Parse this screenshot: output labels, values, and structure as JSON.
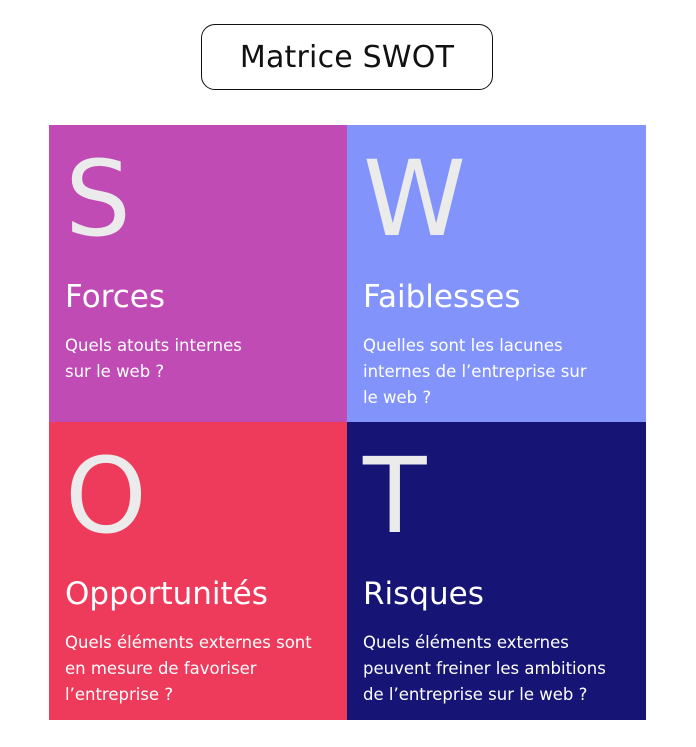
{
  "title": "Matrice SWOT",
  "colors": {
    "strengths": "#c14bb5",
    "weaknesses": "#8294fb",
    "opportunities": "#ee3a5b",
    "threats": "#161576"
  },
  "quadrants": [
    {
      "letter": "S",
      "heading": "Forces",
      "description": "Quels atouts internes\nsur le web ?"
    },
    {
      "letter": "W",
      "heading": "Faiblesses",
      "description": "Quelles sont les lacunes\ninternes de l’entreprise sur\nle web ?"
    },
    {
      "letter": "O",
      "heading": "Opportunités",
      "description": "Quels éléments externes sont\nen mesure de favoriser\nl’entreprise ?"
    },
    {
      "letter": "T",
      "heading": "Risques",
      "description": "Quels éléments externes\npeuvent freiner les ambitions\nde l’entreprise sur le web ?"
    }
  ]
}
